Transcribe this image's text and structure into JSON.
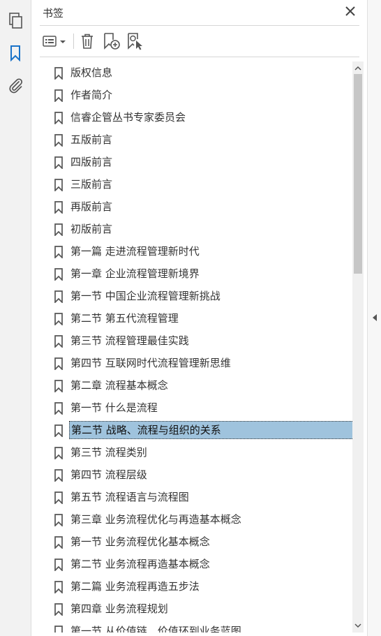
{
  "panel": {
    "title": "书签"
  },
  "leftrail": {
    "items": [
      {
        "icon": "pages-icon"
      },
      {
        "icon": "bookmark-icon",
        "active": true
      },
      {
        "icon": "attachment-icon"
      }
    ]
  },
  "toolbar": {
    "options_icon": "options-list-icon",
    "delete_icon": "trash-icon",
    "new_bookmark_icon": "new-bookmark-icon",
    "find_bookmark_icon": "find-current-bookmark-icon"
  },
  "bookmarks": [
    {
      "label": "版权信息"
    },
    {
      "label": "作者简介"
    },
    {
      "label": "信睿企管丛书专家委员会"
    },
    {
      "label": "五版前言"
    },
    {
      "label": "四版前言"
    },
    {
      "label": "三版前言"
    },
    {
      "label": "再版前言"
    },
    {
      "label": "初版前言"
    },
    {
      "label": "第一篇 走进流程管理新时代"
    },
    {
      "label": "第一章 企业流程管理新境界"
    },
    {
      "label": "第一节 中国企业流程管理新挑战"
    },
    {
      "label": "第二节 第五代流程管理"
    },
    {
      "label": "第三节 流程管理最佳实践"
    },
    {
      "label": "第四节 互联网时代流程管理新思维"
    },
    {
      "label": "第二章 流程基本概念"
    },
    {
      "label": "第一节 什么是流程"
    },
    {
      "label": "第二节 战略、流程与组织的关系",
      "selected": true
    },
    {
      "label": "第三节 流程类别"
    },
    {
      "label": "第四节 流程层级"
    },
    {
      "label": "第五节 流程语言与流程图"
    },
    {
      "label": "第三章 业务流程优化与再造基本概念"
    },
    {
      "label": "第一节 业务流程优化基本概念"
    },
    {
      "label": "第二节 业务流程再造基本概念"
    },
    {
      "label": "第二篇 业务流程再造五步法"
    },
    {
      "label": "第四章 业务流程规划"
    },
    {
      "label": "第一节 从价值链、价值环到业务蓝图"
    }
  ],
  "colors": {
    "selection": "#9fc3dd",
    "accent": "#1a73c9",
    "icon": "#555555"
  }
}
